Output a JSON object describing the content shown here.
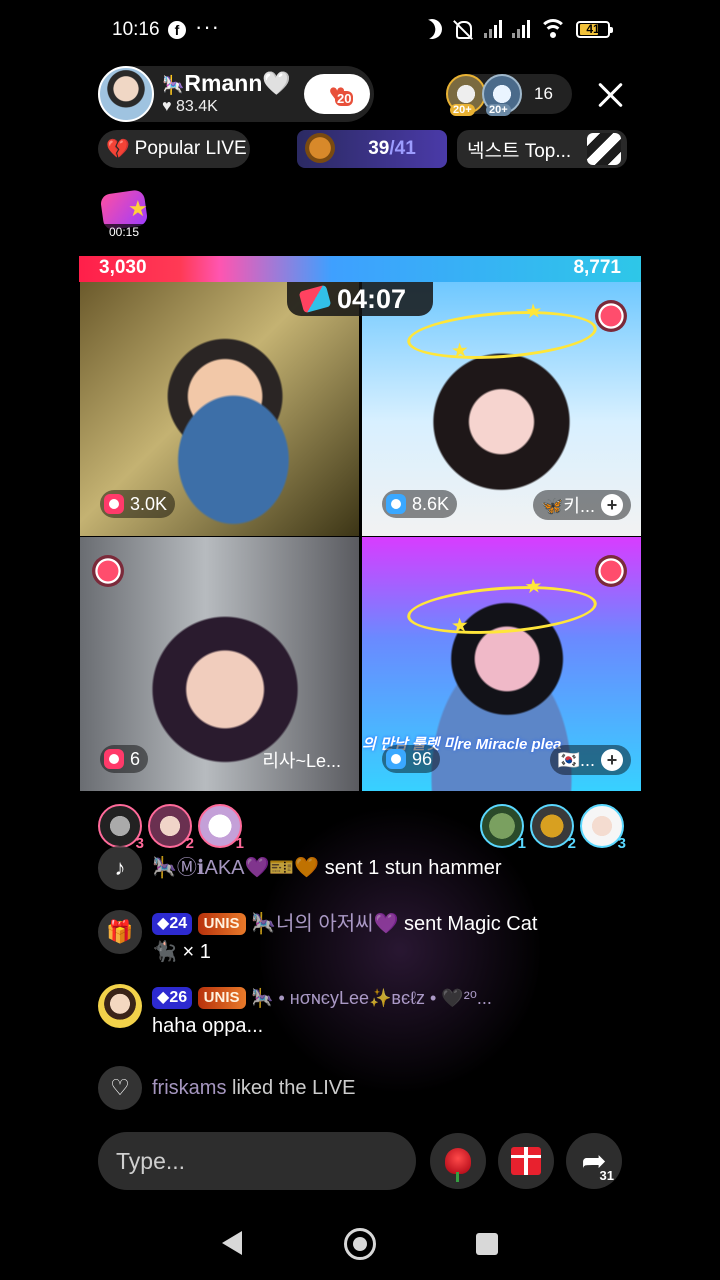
{
  "status_bar": {
    "time": "10:16",
    "notification_icons": [
      "facebook-icon",
      "more-dots-icon"
    ],
    "right_icons": [
      "do-not-disturb-moon-icon",
      "mute-icon",
      "signal-icon",
      "signal-icon",
      "wifi-icon",
      "battery-icon"
    ],
    "battery": "41"
  },
  "header": {
    "host_name": "Rmann",
    "host_likes": "83.4K",
    "follow_badge": "20",
    "viewer_badges": [
      "20+",
      "20+"
    ],
    "viewer_count": "16"
  },
  "chips": {
    "popular_live": "Popular LIVE",
    "rank_current": "39",
    "rank_total": "/41",
    "next": "넥스트 Top..."
  },
  "gift_timer": "00:15",
  "battle": {
    "left_score": "3,030",
    "right_score": "8,771",
    "timer": "04:07",
    "colors": {
      "red": "#ff1f4a",
      "blue": "#2ec7e8"
    }
  },
  "tiles": [
    {
      "stat": "3.0K",
      "name": ""
    },
    {
      "stat": "8.6K",
      "name": "🦋키..."
    },
    {
      "stat": "6",
      "name": "리사~Le..."
    },
    {
      "stat": "96",
      "name": "🇰🇷...",
      "caption": "의 만남 룰렛  미re  Miracle plea"
    }
  ],
  "supporters": {
    "left": [
      "3",
      "2",
      "1"
    ],
    "right": [
      "1",
      "2",
      "3"
    ]
  },
  "chat": [
    {
      "icon": "tiktok-icon",
      "user": "🎠ⓂℹAKA💜🎫🧡",
      "text": "sent 1 stun hammer"
    },
    {
      "icon": "gift-icon",
      "level": "24",
      "club": "UNIS",
      "user": "🎠너의 아저씨💜",
      "text": "sent Magic Cat",
      "extra": "× 1"
    },
    {
      "icon": "avatar",
      "level": "26",
      "club": "UNIS",
      "user": "🎠 • нσɴєуLee✨вєℓz • 🖤²⁰...",
      "text": "haha oppa..."
    },
    {
      "icon": "heart-icon",
      "user": "friskams",
      "text": "liked the LIVE"
    }
  ],
  "input": {
    "placeholder": "Type...",
    "share_count": "31"
  }
}
